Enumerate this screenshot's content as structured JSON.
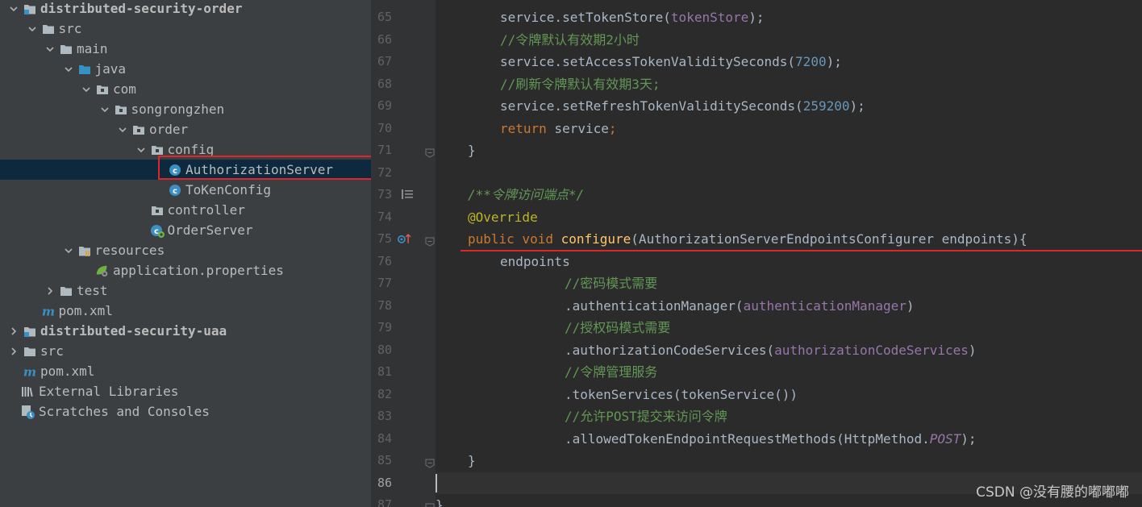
{
  "project_tree": {
    "items": [
      {
        "label": "distributed-security-order",
        "bold": true,
        "arrow": "down",
        "icon": "module-folder-icon",
        "indent": 0
      },
      {
        "label": "src",
        "arrow": "down",
        "icon": "folder-icon",
        "indent": 1
      },
      {
        "label": "main",
        "arrow": "down",
        "icon": "folder-icon",
        "indent": 2
      },
      {
        "label": "java",
        "arrow": "down",
        "icon": "source-folder-icon",
        "indent": 3
      },
      {
        "label": "com",
        "arrow": "down",
        "icon": "package-icon",
        "indent": 4
      },
      {
        "label": "songrongzhen",
        "arrow": "down",
        "icon": "package-icon",
        "indent": 5
      },
      {
        "label": "order",
        "arrow": "down",
        "icon": "package-icon",
        "indent": 6
      },
      {
        "label": "config",
        "arrow": "down",
        "icon": "package-icon",
        "indent": 7
      },
      {
        "label": "AuthorizationServer",
        "arrow": "none",
        "icon": "class-icon",
        "indent": 8,
        "selected": true
      },
      {
        "label": "ToKenConfig",
        "arrow": "none",
        "icon": "class-icon",
        "indent": 8
      },
      {
        "label": "controller",
        "arrow": "none",
        "icon": "package-icon",
        "indent": 7
      },
      {
        "label": "OrderServer",
        "arrow": "none",
        "icon": "spring-class-icon",
        "indent": 7
      },
      {
        "label": "resources",
        "arrow": "down",
        "icon": "resources-folder-icon",
        "indent": 3
      },
      {
        "label": "application.properties",
        "arrow": "none",
        "icon": "properties-file-icon",
        "indent": 4
      },
      {
        "label": "test",
        "arrow": "right",
        "icon": "folder-icon",
        "indent": 2
      },
      {
        "label": "pom.xml",
        "arrow": "none",
        "icon": "maven-icon",
        "indent": 1
      },
      {
        "label": "distributed-security-uaa",
        "bold": true,
        "arrow": "right",
        "icon": "module-folder-icon",
        "indent": 0
      },
      {
        "label": "src",
        "arrow": "right",
        "icon": "folder-icon",
        "indent": 0
      },
      {
        "label": "pom.xml",
        "arrow": "none",
        "icon": "maven-icon",
        "indent": 0
      },
      {
        "label": "External Libraries",
        "arrow": "none",
        "icon": "libraries-icon",
        "indent": -1
      },
      {
        "label": "Scratches and Consoles",
        "arrow": "none",
        "icon": "scratches-icon",
        "indent": -1
      }
    ]
  },
  "editor": {
    "current_line": "86",
    "lines": [
      {
        "num": "65",
        "indent": 2,
        "tokens": [
          [
            "p",
            "service.setTokenStore("
          ],
          [
            "fld",
            "tokenStore"
          ],
          [
            "p",
            ");"
          ]
        ]
      },
      {
        "num": "66",
        "indent": 2,
        "tokens": [
          [
            "cm",
            "//令牌默认有效期2小时"
          ]
        ]
      },
      {
        "num": "67",
        "indent": 2,
        "tokens": [
          [
            "p",
            "service.setAccessTokenValiditySeconds("
          ],
          [
            "num",
            "7200"
          ],
          [
            "p",
            ");"
          ]
        ]
      },
      {
        "num": "68",
        "indent": 2,
        "tokens": [
          [
            "cm",
            "//刷新令牌默认有效期3天;"
          ]
        ]
      },
      {
        "num": "69",
        "indent": 2,
        "tokens": [
          [
            "p",
            "service.setRefreshTokenValiditySeconds("
          ],
          [
            "num",
            "259200"
          ],
          [
            "p",
            ");"
          ]
        ]
      },
      {
        "num": "70",
        "indent": 2,
        "tokens": [
          [
            "kw",
            "return"
          ],
          [
            "p",
            " service"
          ],
          [
            "kw",
            ";"
          ]
        ]
      },
      {
        "num": "71",
        "indent": 1,
        "tokens": [
          [
            "p",
            "}"
          ]
        ],
        "fold": true
      },
      {
        "num": "72",
        "indent": 0,
        "tokens": []
      },
      {
        "num": "73",
        "indent": 1,
        "tokens": [
          [
            "cmi",
            "/**令牌访问端点*/"
          ]
        ],
        "doc": true
      },
      {
        "num": "74",
        "indent": 1,
        "tokens": [
          [
            "ann",
            "@Override"
          ]
        ]
      },
      {
        "num": "75",
        "indent": 1,
        "tokens": [
          [
            "kw",
            "public void "
          ],
          [
            "fn",
            "configure"
          ],
          [
            "p",
            "(AuthorizationServerEndpointsConfigurer endpoints){"
          ]
        ],
        "fold": true,
        "override": true
      },
      {
        "num": "76",
        "indent": 2,
        "tokens": [
          [
            "p",
            "endpoints"
          ]
        ]
      },
      {
        "num": "77",
        "indent": 4,
        "tokens": [
          [
            "cm",
            "//密码模式需要"
          ]
        ]
      },
      {
        "num": "78",
        "indent": 4,
        "tokens": [
          [
            "p",
            ".authenticationManager("
          ],
          [
            "fld",
            "authenticationManager"
          ],
          [
            "p",
            ")"
          ]
        ]
      },
      {
        "num": "79",
        "indent": 4,
        "tokens": [
          [
            "cm",
            "//授权码模式需要"
          ]
        ]
      },
      {
        "num": "80",
        "indent": 4,
        "tokens": [
          [
            "p",
            ".authorizationCodeServices("
          ],
          [
            "fld",
            "authorizationCodeServices"
          ],
          [
            "p",
            ")"
          ]
        ]
      },
      {
        "num": "81",
        "indent": 4,
        "tokens": [
          [
            "cm",
            "//令牌管理服务"
          ]
        ]
      },
      {
        "num": "82",
        "indent": 4,
        "tokens": [
          [
            "p",
            ".tokenServices(tokenService())"
          ]
        ]
      },
      {
        "num": "83",
        "indent": 4,
        "tokens": [
          [
            "cm",
            "//允许POST提交来访问令牌"
          ]
        ]
      },
      {
        "num": "84",
        "indent": 4,
        "tokens": [
          [
            "p",
            ".allowedTokenEndpointRequestMethods(HttpMethod."
          ],
          [
            "fldi",
            "POST"
          ],
          [
            "p",
            ");"
          ]
        ]
      },
      {
        "num": "85",
        "indent": 1,
        "tokens": [
          [
            "p",
            "}"
          ]
        ],
        "fold": true
      },
      {
        "num": "86",
        "indent": 0,
        "tokens": []
      },
      {
        "num": "87",
        "indent": 0,
        "tokens": [
          [
            "p",
            "}"
          ]
        ],
        "fold": true
      }
    ]
  },
  "watermark": "CSDN @没有腰的嘟嘟嘟",
  "colors": {
    "tree_bg": "#3c3f41",
    "editor_bg": "#2b2b2b",
    "selection": "#0d293e",
    "highlight_red": "#e0242a"
  }
}
